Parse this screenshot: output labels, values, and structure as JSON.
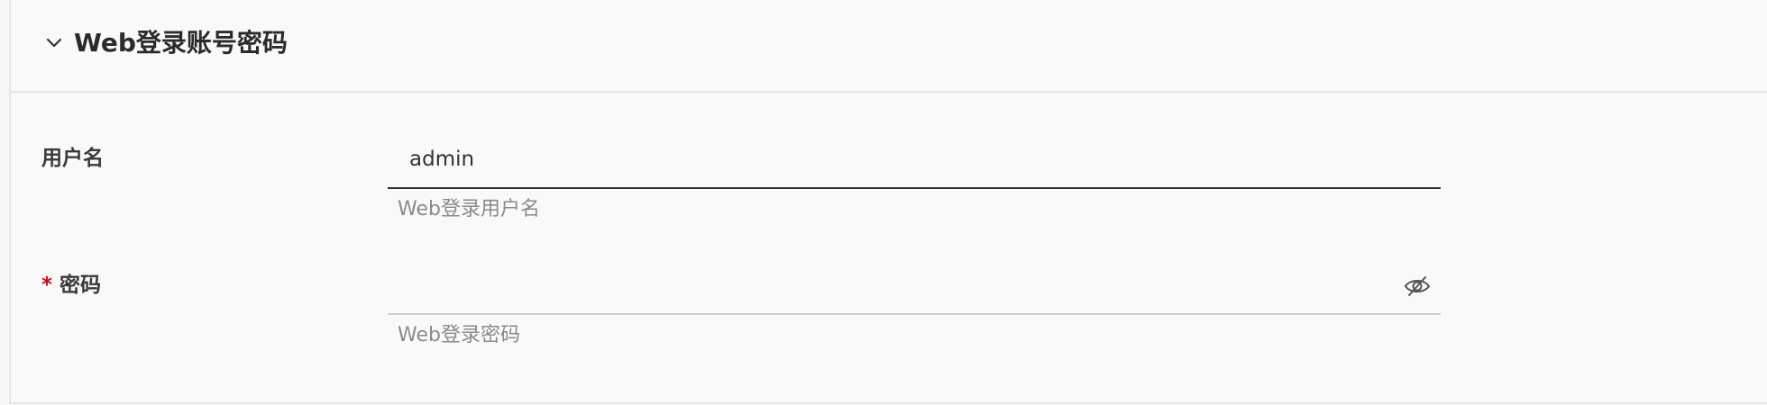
{
  "section": {
    "title": "Web登录账号密码",
    "collapse_icon": "chevron-down-icon"
  },
  "username": {
    "label": "用户名",
    "value": "admin",
    "helper": "Web登录用户名"
  },
  "password": {
    "required_marker": "*",
    "label": "密码",
    "value": "",
    "helper": "Web登录密码",
    "visibility_icon": "eye-off-icon"
  },
  "colors": {
    "required": "#d9001b",
    "helper": "#8a8a8a",
    "active_underline": "#2f2f2f",
    "inactive_underline": "#cfcfcf"
  }
}
